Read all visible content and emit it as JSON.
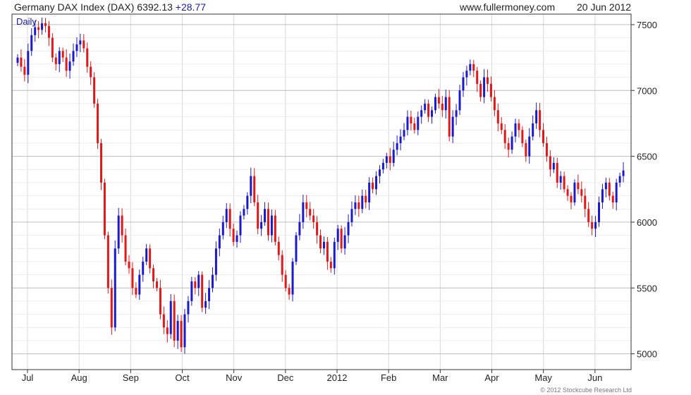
{
  "header": {
    "title": "Germany DAX Index (DAX)",
    "last": "6392.13",
    "change": "+28.77",
    "site": "www.fullermoney.com",
    "date": "20 Jun 2012"
  },
  "copyright": "© 2012 Stockcube Research Ltd",
  "colors": {
    "up": "#1a1acc",
    "down": "#e01818",
    "grid": "#d8d8d8",
    "frame": "#333333"
  },
  "chart_data": {
    "type": "candlestick",
    "period_label": "Daily",
    "ylim": [
      4880,
      7580
    ],
    "y_ticks": [
      5000,
      5500,
      6000,
      6500,
      7000,
      7500
    ],
    "x_ticks": [
      "Jul",
      "Aug",
      "Sep",
      "Oct",
      "Nov",
      "Dec",
      "2012",
      "Feb",
      "Mar",
      "Apr",
      "May",
      "Jun"
    ],
    "closes": [
      7250,
      7180,
      7120,
      7300,
      7420,
      7480,
      7460,
      7510,
      7490,
      7400,
      7250,
      7200,
      7300,
      7250,
      7150,
      7220,
      7300,
      7350,
      7380,
      7320,
      7180,
      7100,
      6900,
      6600,
      6300,
      5900,
      5500,
      5200,
      5800,
      6050,
      5900,
      5700,
      5650,
      5500,
      5450,
      5600,
      5700,
      5800,
      5650,
      5550,
      5500,
      5300,
      5200,
      5150,
      5400,
      5100,
      5250,
      5050,
      5300,
      5400,
      5550,
      5500,
      5600,
      5350,
      5400,
      5500,
      5600,
      5800,
      5900,
      6000,
      6100,
      5950,
      5850,
      5900,
      6050,
      6100,
      6200,
      6350,
      6150,
      5950,
      6000,
      6100,
      5900,
      6050,
      5850,
      5750,
      5600,
      5500,
      5450,
      5700,
      5900,
      6000,
      6150,
      6100,
      6050,
      6000,
      5900,
      5800,
      5850,
      5700,
      5650,
      5850,
      5950,
      5800,
      5900,
      6000,
      6100,
      6150,
      6100,
      6200,
      6150,
      6300,
      6250,
      6350,
      6400,
      6450,
      6500,
      6450,
      6550,
      6600,
      6650,
      6700,
      6800,
      6750,
      6700,
      6800,
      6850,
      6900,
      6800,
      6850,
      6950,
      6900,
      6850,
      6950,
      6650,
      6800,
      6850,
      7000,
      7100,
      7150,
      7200,
      7150,
      7050,
      6950,
      7100,
      7050,
      6950,
      6850,
      6750,
      6700,
      6600,
      6550,
      6650,
      6750,
      6700,
      6600,
      6500,
      6650,
      6750,
      6850,
      6700,
      6600,
      6500,
      6400,
      6450,
      6300,
      6350,
      6250,
      6200,
      6150,
      6300,
      6250,
      6200,
      6100,
      6000,
      5950,
      6000,
      6150,
      6250,
      6300,
      6200,
      6150,
      6300,
      6350,
      6392
    ]
  }
}
